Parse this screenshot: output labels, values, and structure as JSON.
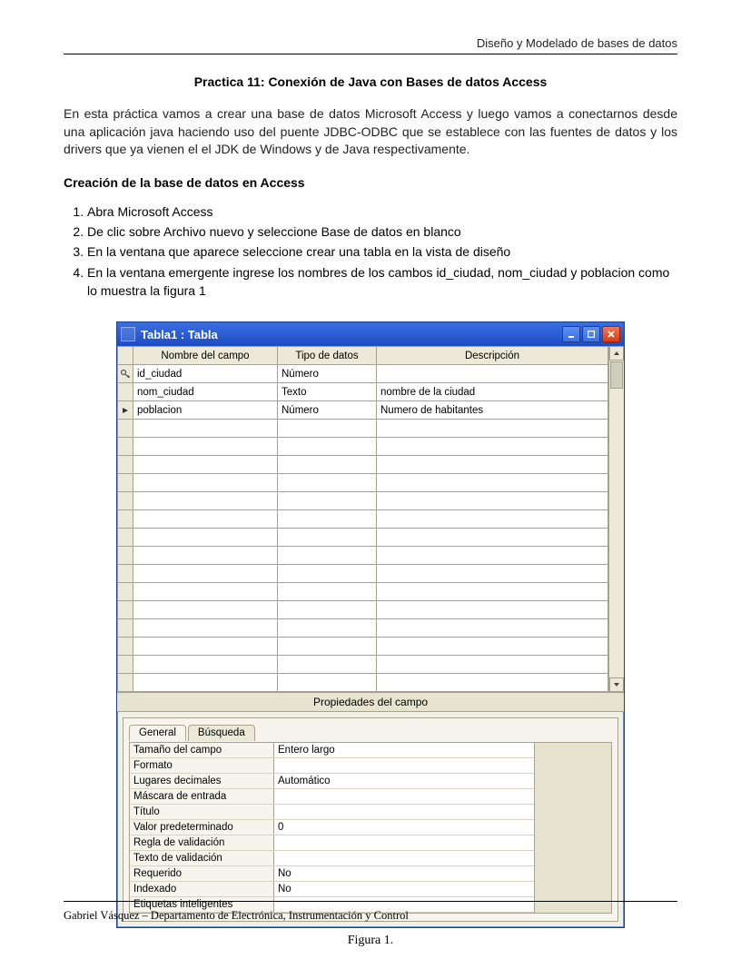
{
  "header": {
    "running_title": "Diseño y Modelado de bases de datos"
  },
  "title": "Practica 11: Conexión de Java con Bases de datos Access",
  "intro": "En esta práctica vamos a crear una base de datos Microsoft Access y luego vamos a conectarnos desde una aplicación java haciendo uso del puente JDBC-ODBC que se establece con las fuentes de datos y los drivers que ya vienen el el JDK de Windows y de Java respectivamente.",
  "section_heading": "Creación de la base de datos en Access",
  "steps": [
    "Abra Microsoft Access",
    "De clic sobre Archivo nuevo y seleccione Base de datos en blanco",
    "En la ventana que aparece seleccione crear una tabla en la vista de diseño",
    "En la ventana emergente ingrese los nombres de los cambos id_ciudad, nom_ciudad y poblacion como lo muestra la figura 1"
  ],
  "access_window": {
    "title": "Tabla1 : Tabla",
    "columns": {
      "name": "Nombre del campo",
      "type": "Tipo de datos",
      "desc": "Descripción"
    },
    "rows": [
      {
        "marker": "key",
        "name": "id_ciudad",
        "type": "Número",
        "desc": ""
      },
      {
        "marker": "",
        "name": "nom_ciudad",
        "type": "Texto",
        "desc": "nombre de la ciudad"
      },
      {
        "marker": "arrow",
        "name": "poblacion",
        "type": "Número",
        "desc": "Numero de habitantes"
      }
    ],
    "empty_rows": 15,
    "prop_caption": "Propiedades del campo",
    "tabs": {
      "general": "General",
      "lookup": "Búsqueda"
    },
    "properties": [
      {
        "label": "Tamaño del campo",
        "value": "Entero largo"
      },
      {
        "label": "Formato",
        "value": ""
      },
      {
        "label": "Lugares decimales",
        "value": "Automático"
      },
      {
        "label": "Máscara de entrada",
        "value": ""
      },
      {
        "label": "Título",
        "value": ""
      },
      {
        "label": "Valor predeterminado",
        "value": "0"
      },
      {
        "label": "Regla de validación",
        "value": ""
      },
      {
        "label": "Texto de validación",
        "value": ""
      },
      {
        "label": "Requerido",
        "value": "No"
      },
      {
        "label": "Indexado",
        "value": "No"
      },
      {
        "label": "Etiquetas inteligentes",
        "value": ""
      }
    ]
  },
  "figure_caption": "Figura 1.",
  "footer": "Gabriel Vásquez – Departamento de Electrónica, Instrumentación y Control"
}
